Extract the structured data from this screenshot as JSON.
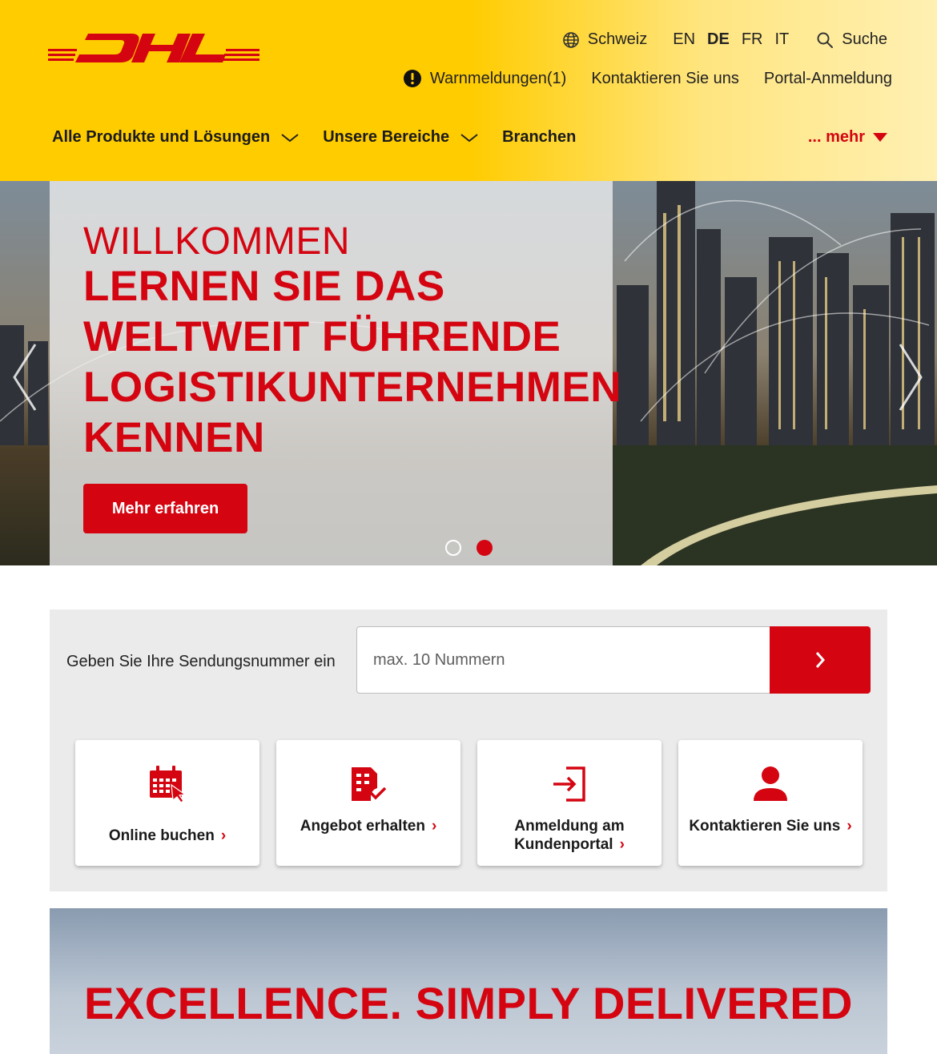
{
  "brand": {
    "logo_text": "DHL",
    "accent": "#d40511",
    "yellow": "#ffcc00"
  },
  "header": {
    "country": "Schweiz",
    "languages": [
      {
        "code": "EN",
        "active": false
      },
      {
        "code": "DE",
        "active": true
      },
      {
        "code": "FR",
        "active": false
      },
      {
        "code": "IT",
        "active": false
      }
    ],
    "search_label": "Suche",
    "alerts_label": "Warnmeldungen(1)",
    "contact_label": "Kontaktieren Sie uns",
    "portal_label": "Portal-Anmeldung"
  },
  "nav": {
    "items": [
      {
        "label": "Alle Produkte und Lösungen",
        "has_dropdown": true
      },
      {
        "label": "Unsere Bereiche",
        "has_dropdown": true
      },
      {
        "label": "Branchen",
        "has_dropdown": false
      }
    ],
    "more_label": "... mehr"
  },
  "hero": {
    "welcome": "WILLKOMMEN",
    "title": "LERNEN SIE DAS WELTWEIT FÜHRENDE LOGISTIKUNTERNEHMEN KENNEN",
    "cta": "Mehr erfahren",
    "slides": 2,
    "active_slide": 2
  },
  "tracking": {
    "label": "Geben Sie Ihre Sendungsnummer ein",
    "placeholder": "max. 10 Nummern"
  },
  "quick_links": [
    {
      "label": "Online buchen",
      "icon": "calendar-booking-icon"
    },
    {
      "label": "Angebot erhalten",
      "icon": "quote-document-icon"
    },
    {
      "label": "Anmeldung am Kundenportal",
      "icon": "portal-login-icon"
    },
    {
      "label": "Kontaktieren Sie uns",
      "icon": "contact-person-icon"
    }
  ],
  "banner": {
    "title": "EXCELLENCE. SIMPLY DELIVERED"
  }
}
